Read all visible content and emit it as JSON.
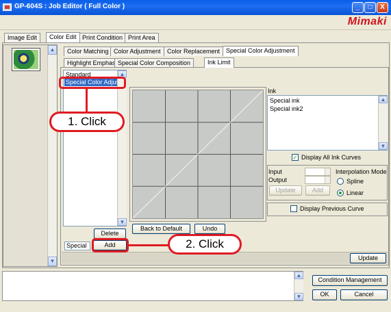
{
  "window": {
    "title": "GP-604S : Job Editor ( Full Color )",
    "logo": "Mimaki",
    "controls": [
      "_",
      "□",
      "X"
    ]
  },
  "main_tabs": [
    "Image Edit",
    "Color Edit",
    "Print Condition",
    "Print Area"
  ],
  "sub_tabs": [
    "Color Matching",
    "Color Adjustment",
    "Color Replacement",
    "Special Color Adjustment"
  ],
  "sub_sub_tabs": [
    "Highlight Emphasis",
    "Special Color Composition",
    "Ink Limit"
  ],
  "special_list": {
    "items": [
      "Standard",
      "Special Color Adjus"
    ],
    "selected_index": 1,
    "delete_label": "Delete",
    "name_value": "Special",
    "add_label": "Add"
  },
  "graph_buttons": {
    "back_to_default": "Back to Default",
    "undo": "Undo"
  },
  "ink_panel": {
    "title": "Ink",
    "items": [
      "Special ink",
      "Special ink2"
    ],
    "display_all_label": "Display All Ink Curves",
    "display_all_checked": true,
    "input_label": "Input",
    "output_label": "Output",
    "update_small": "Update",
    "add_small": "Add",
    "interp_label": "Interpolation Mode",
    "spline_label": "Spline",
    "linear_label": "Linear",
    "selected_mode": "Linear",
    "display_prev_label": "Display Previous Curve",
    "display_prev_checked": false
  },
  "update_label": "Update",
  "bottom": {
    "condition_label": "Condition Management",
    "ok_label": "OK",
    "cancel_label": "Cancel"
  },
  "callouts": {
    "first": "1. Click",
    "second": "2. Click"
  },
  "colors": {
    "title_bar": "#0a5ee8",
    "logo": "#d0121b",
    "selection": "#316ac5",
    "callout_red": "#e01a22"
  }
}
